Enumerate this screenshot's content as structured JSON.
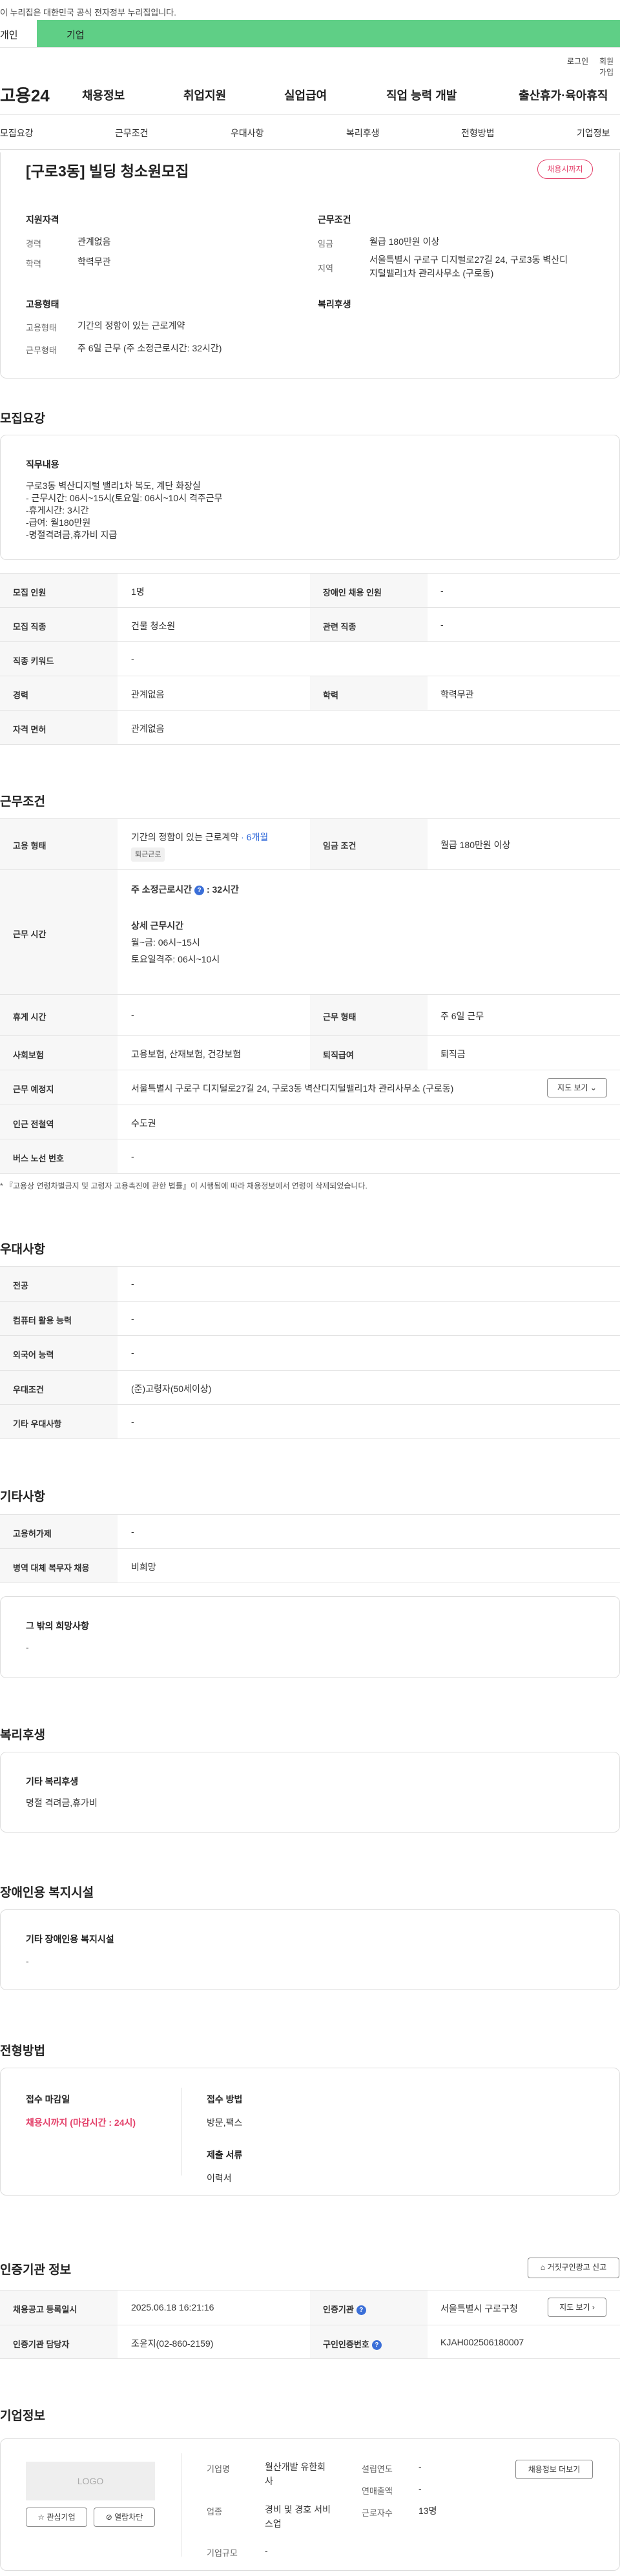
{
  "gov_banner": "이 누리집은 대한민국 공식 전자정부 누리집입니다.",
  "top_tabs": [
    "개인",
    "기업"
  ],
  "util": {
    "login": "로그인",
    "join": "회원가입"
  },
  "logo": "고용24",
  "gnb": [
    "채용정보",
    "취업지원",
    "실업급여",
    "직업 능력 개발",
    "출산휴가·육아휴직"
  ],
  "snb": [
    "모집요강",
    "근무조건",
    "우대사항",
    "복리후생",
    "전형방법",
    "기업정보"
  ],
  "summary": {
    "title": "[구로3동] 빌딩 청소원모집",
    "badge": "채용시까지",
    "qual_head": "지원자격",
    "career_k": "경력",
    "career_v": "관계없음",
    "edu_k": "학력",
    "edu_v": "학력무관",
    "emp_head": "고용형태",
    "emp_k": "고용형태",
    "emp_v": "기간의 정함이 있는 근로계약",
    "work_k": "근무형태",
    "work_v": "주 6일 근무 (주 소정근로시간: 32시간)",
    "cond_head": "근무조건",
    "wage_k": "임금",
    "wage_v": "월급 180만원 이상",
    "area_k": "지역",
    "area_v1": "서울특별시 구로구 디지털로27길 24, 구로3동 벽산디",
    "area_v2": "지털밸리1차 관리사무소 (구로동)",
    "welfare_head": "복리후생"
  },
  "recruit": {
    "heading": "모집요강",
    "duty_head": "직무내용",
    "duty_lines": [
      "구로3동 벽산디지털 밸리1차 복도, 계단 화장실",
      "- 근무시간: 06시~15시(토요일: 06시~10시 격주근무",
      "-휴게시간: 3시간",
      "-급여: 월180만원",
      "-명절격려금,휴가비 지급"
    ],
    "rows": [
      {
        "k": "모집 인원",
        "v": "1명",
        "k2": "장애인 채용 인원",
        "v2": "-"
      },
      {
        "k": "모집 직종",
        "v": "건물 청소원",
        "k2": "관련 직종",
        "v2": "-"
      },
      {
        "k": "직종 키워드",
        "v": "-"
      },
      {
        "k": "경력",
        "v": "관계없음",
        "k2": "학력",
        "v2": "학력무관"
      },
      {
        "k": "자격 면허",
        "v": "관계없음"
      }
    ]
  },
  "work": {
    "heading": "근무조건",
    "emp_k": "고용 형태",
    "emp_v": "기간의 정함이 있는 근로계약",
    "emp_period": "· 6개월",
    "emp_chip": "퇴근근로",
    "wage_k": "임금 조건",
    "wage_v": "월급 180만원 이상",
    "time_k": "근무 시간",
    "time_lines": [
      "주 소정근로시간",
      "32시간",
      "상세 근무시간",
      "월~금: 06시~15시",
      "토요일격주: 06시~10시"
    ],
    "rest_k": "휴게 시간",
    "rest_v": "-",
    "type_k": "근무 형태",
    "type_v": "주 6일 근무",
    "ins_k": "사회보험",
    "ins_v": "고용보험, 산재보험, 건강보험",
    "sev_k": "퇴직급여",
    "sev_v": "퇴직금",
    "place_k": "근무 예정지",
    "place_v": "서울특별시 구로구 디지털로27길 24, 구로3동 벽산디지털밸리1차 관리사무소 (구로동)",
    "map_btn": "지도 보기",
    "subway_k": "인근 전철역",
    "subway_v": "수도권",
    "bus_k": "버스 노선 번호",
    "bus_v": "-",
    "note": "* 『고용상 연령차별금지 및 고령자 고용촉진에 관한 법률』이 시행됨에 따라 채용정보에서 연령이 삭제되었습니다."
  },
  "pref": {
    "heading": "우대사항",
    "rows": [
      {
        "k": "전공",
        "v": "-"
      },
      {
        "k": "컴퓨터 활용 능력",
        "v": "-"
      },
      {
        "k": "외국어 능력",
        "v": "-"
      },
      {
        "k": "우대조건",
        "v": "(준)고령자(50세이상)"
      },
      {
        "k": "기타 우대사항",
        "v": "-"
      }
    ]
  },
  "etc": {
    "heading": "기타사항",
    "rows": [
      {
        "k": "고용허가제",
        "v": "-"
      },
      {
        "k": "병역 대체 복무자 채용",
        "v": "비희망"
      }
    ],
    "box_head": "그 밖의 희망사항",
    "box_v": "-"
  },
  "welfare": {
    "heading": "복리후생",
    "box_head": "기타 복리후생",
    "box_v": "명절 격려금,휴가비"
  },
  "disabled": {
    "heading": "장애인용 복지시설",
    "box_head": "기타 장애인용 복지시설",
    "box_v": "-"
  },
  "selection": {
    "heading": "전형방법",
    "deadline_k": "접수 마감일",
    "deadline_v": "채용시까지 (마감시간 : 24시)",
    "method_k": "접수 방법",
    "method_v": "방문,팩스",
    "docs_k": "제출 서류",
    "docs_v": "이력서"
  },
  "agency": {
    "heading": "인증기관 정보",
    "report_btn": "거짓구인광고 신고",
    "reg_k": "채용공고 등록일시",
    "reg_v": "2025.06.18 16:21:16",
    "org_k": "인증기관",
    "org_v": "서울특별시 구로구청",
    "map_btn": "지도 보기",
    "mgr_k": "인증기관 담당자",
    "mgr_v": "조윤지(02-860-2159)",
    "no_k": "구인인증번호",
    "no_v": "KJAH002506180007"
  },
  "company": {
    "heading": "기업정보",
    "logo": "LOGO",
    "fav_btn": "관심기업",
    "block_btn": "열람차단",
    "name_k": "기업명",
    "name_v1": "월산개발 유한회",
    "name_v2": "사",
    "biz_k": "업종",
    "biz_v1": "경비 및 경호 서비",
    "biz_v2": "스업",
    "size_k": "기업규모",
    "size_v": "-",
    "year_k": "설립연도",
    "year_v": "-",
    "sales_k": "연매출액",
    "sales_v": "-",
    "emp_k": "근로자수",
    "emp_v": "13명",
    "info_btn": "채용정보 더보기"
  }
}
